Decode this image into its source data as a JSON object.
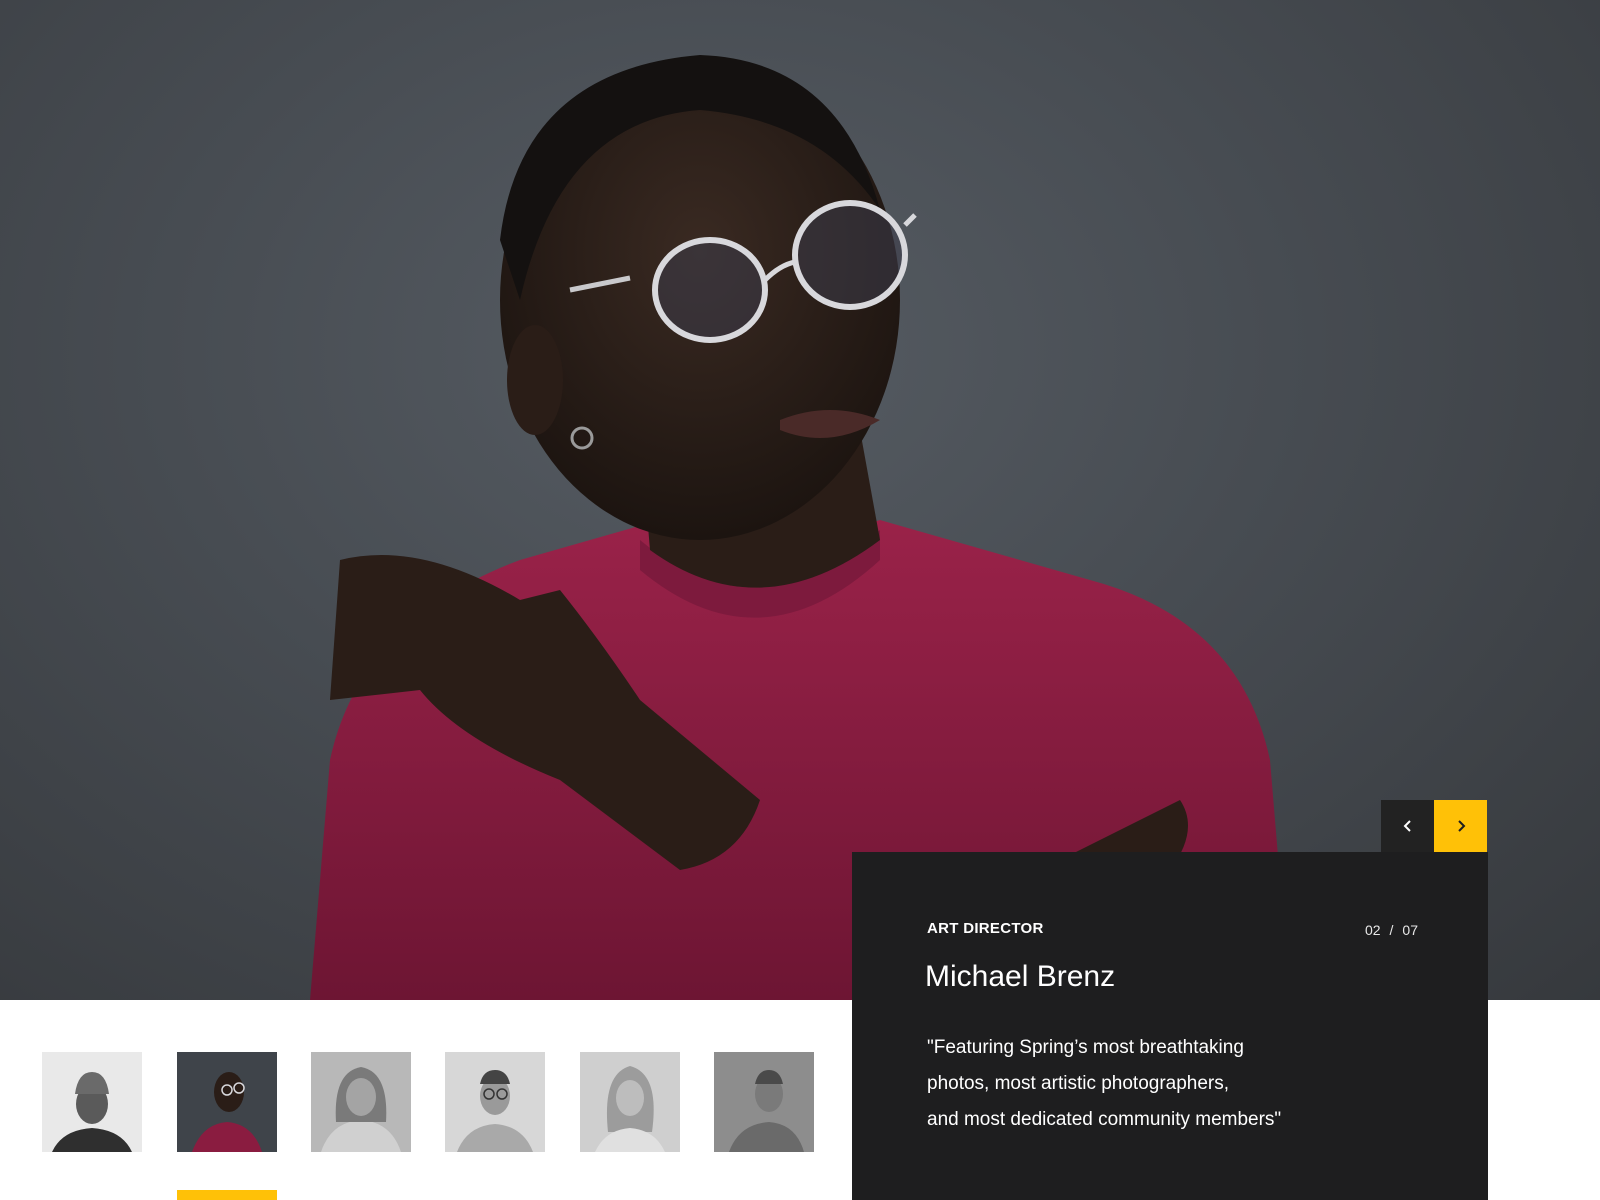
{
  "profile": {
    "role": "ART DIRECTOR",
    "name": "Michael Brenz",
    "quote_lines": [
      "\"Featuring Spring’s most breathtaking",
      "photos, most artistic photographers,",
      "and most dedicated community members\""
    ]
  },
  "counter": {
    "current": "02",
    "separator": "/",
    "total": "07"
  },
  "navigation": {
    "prev_icon": "chevron-left-icon",
    "next_icon": "chevron-right-icon"
  },
  "thumbnails": {
    "count": 6,
    "active_index": 1
  },
  "colors": {
    "accent": "#ffc107",
    "card_bg": "#1e1e1f",
    "prev_bg": "#222222",
    "sweater": "#8a1c40",
    "backdrop": "#474c52"
  }
}
